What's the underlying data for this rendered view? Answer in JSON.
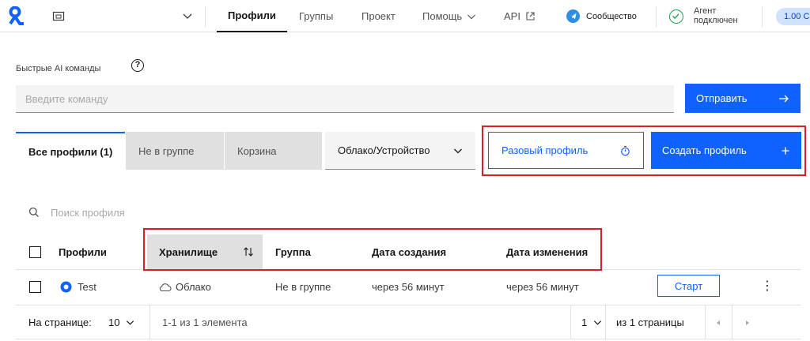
{
  "topbar": {
    "nav": [
      "Профили",
      "Группы",
      "Проект",
      "Помощь",
      "API"
    ],
    "community": "Сообщество",
    "agent_line1": "Агент",
    "agent_line2": "подключен",
    "version": "1.00 C"
  },
  "ai": {
    "label": "Быстрые AI команды",
    "help": "?",
    "placeholder": "Введите команду",
    "send_label": "Отправить"
  },
  "tabs": [
    "Все профили (1)",
    "Не в группе",
    "Корзина"
  ],
  "filter": {
    "selected": "Облако/Устройство"
  },
  "buttons": {
    "one_time": "Разовый профиль",
    "create": "Создать профиль"
  },
  "search": {
    "placeholder": "Поиск профиля"
  },
  "table": {
    "headers": [
      "Профили",
      "Хранилище",
      "Группа",
      "Дата создания",
      "Дата изменения"
    ],
    "rows": [
      {
        "name": "Test",
        "storage": "Облако",
        "group": "Не в группе",
        "created": "через 56 минут",
        "modified": "через 56 минут",
        "action": "Старт"
      }
    ]
  },
  "pagination": {
    "per_page_label": "На странице:",
    "per_page": "10",
    "range": "1-1 из 1 элемента",
    "page": "1",
    "total": "из 1 страницы"
  },
  "colors": {
    "accent": "#0f62fe",
    "highlight": "#da1e28",
    "success": "#24a148"
  }
}
